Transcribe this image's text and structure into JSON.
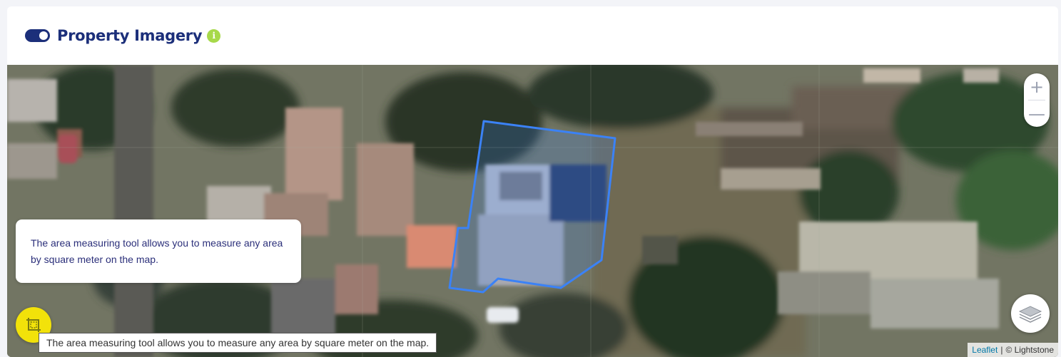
{
  "header": {
    "title": "Property Imagery",
    "info_icon": "i",
    "toggle_state": "on"
  },
  "map": {
    "zoom_in": "+",
    "zoom_out": "—",
    "layers_icon": "layers-icon",
    "measure_icon": "area-measure-icon",
    "info_popup": "The area measuring tool allows you to measure any area by square meter on the map.",
    "tooltip": "The area measuring tool allows you to measure any area by square meter on the map.",
    "attribution": {
      "link": "Leaflet",
      "separator": "|",
      "copyright": "© Lightstone"
    }
  },
  "colors": {
    "brand_navy": "#1c2f7a",
    "info_green": "#a7d94a",
    "measure_yellow": "#f2e20a",
    "boundary_blue": "#3b82f6"
  }
}
